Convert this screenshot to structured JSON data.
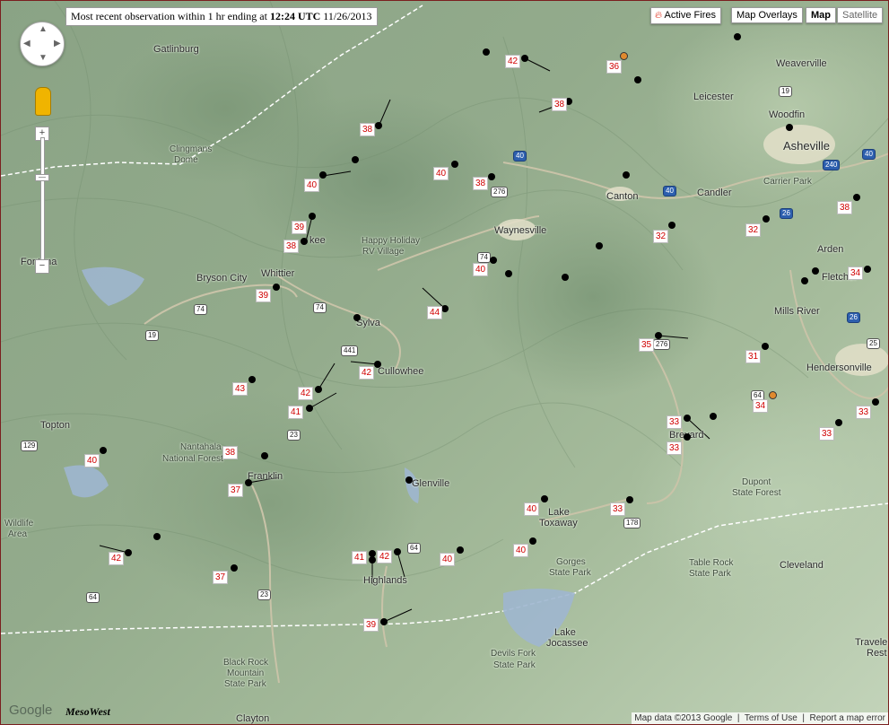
{
  "header": {
    "obs_prefix": "Most recent observation within 1 hr ending at ",
    "obs_time": "12:24 UTC",
    "obs_date": " 11/26/2013"
  },
  "controls": {
    "active_fires": "Active Fires",
    "map_overlays": "Map Overlays",
    "map": "Map",
    "satellite": "Satellite",
    "zoom_in": "+",
    "zoom_out": "−"
  },
  "footer": {
    "google": "Google",
    "mesowest": "MesoWest",
    "map_data": "Map data ©2013 Google",
    "terms": "Terms of Use",
    "report": "Report a map error"
  },
  "places": [
    {
      "name": "Gatlinburg"
    },
    {
      "name": "Clingmans"
    },
    {
      "name": "Dome"
    },
    {
      "name": "Fontana"
    },
    {
      "name": "Bryson City"
    },
    {
      "name": "Whittier"
    },
    {
      "name": "Happy Holiday"
    },
    {
      "name": "RV Village"
    },
    {
      "name": "Sylva"
    },
    {
      "name": "Cullowhee"
    },
    {
      "name": "Waynesville"
    },
    {
      "name": "Canton"
    },
    {
      "name": "Candler"
    },
    {
      "name": "Leicester"
    },
    {
      "name": "Weaverville"
    },
    {
      "name": "Woodfin"
    },
    {
      "name": "Asheville"
    },
    {
      "name": "Carrier Park"
    },
    {
      "name": "Arden"
    },
    {
      "name": "Fletcher"
    },
    {
      "name": "Mills River"
    },
    {
      "name": "Hendersonville"
    },
    {
      "name": "Topton"
    },
    {
      "name": "Nantahala"
    },
    {
      "name": "National Forest"
    },
    {
      "name": "Franklin"
    },
    {
      "name": "Glenville"
    },
    {
      "name": "Lake"
    },
    {
      "name": "Toxaway"
    },
    {
      "name": "Brevard"
    },
    {
      "name": "Dupont"
    },
    {
      "name": "State Forest"
    },
    {
      "name": "Highlands"
    },
    {
      "name": "Gorges"
    },
    {
      "name": "State Park"
    },
    {
      "name": "Table Rock"
    },
    {
      "name": "State Park"
    },
    {
      "name": "Cleveland"
    },
    {
      "name": "Lake"
    },
    {
      "name": "Jocassee"
    },
    {
      "name": "Devils Fork"
    },
    {
      "name": "State Park"
    },
    {
      "name": "Black Rock"
    },
    {
      "name": "Mountain"
    },
    {
      "name": "State Park"
    },
    {
      "name": "Clayton"
    },
    {
      "name": "Travelers"
    },
    {
      "name": "Rest"
    },
    {
      "name": "Wildlife"
    },
    {
      "name": "Area"
    },
    {
      "name": "kee"
    }
  ],
  "highways": [
    "40",
    "40",
    "40",
    "276",
    "74",
    "74",
    "441",
    "19",
    "74",
    "129",
    "23",
    "64",
    "64",
    "23",
    "178",
    "64",
    "26",
    "240",
    "19",
    "25",
    "26",
    "276"
  ],
  "observations": [
    {
      "value": "42",
      "color": "#d00000"
    },
    {
      "value": "36",
      "color": "#d00000"
    },
    {
      "value": "38",
      "color": "#d00000"
    },
    {
      "value": "38",
      "color": "#d00000"
    },
    {
      "value": "40",
      "color": "#d00000"
    },
    {
      "value": "40",
      "color": "#d00000"
    },
    {
      "value": "38",
      "color": "#d00000"
    },
    {
      "value": "39",
      "color": "#d00000"
    },
    {
      "value": "38",
      "color": "#d00000"
    },
    {
      "value": "32",
      "color": "#d00000"
    },
    {
      "value": "32",
      "color": "#d00000"
    },
    {
      "value": "38",
      "color": "#d00000"
    },
    {
      "value": "40",
      "color": "#d00000"
    },
    {
      "value": "34",
      "color": "#d00000"
    },
    {
      "value": "39",
      "color": "#d00000"
    },
    {
      "value": "44",
      "color": "#d00000"
    },
    {
      "value": "35",
      "color": "#d00000"
    },
    {
      "value": "31",
      "color": "#d00000"
    },
    {
      "value": "42",
      "color": "#d00000"
    },
    {
      "value": "43",
      "color": "#d00000"
    },
    {
      "value": "42",
      "color": "#d00000"
    },
    {
      "value": "41",
      "color": "#d00000"
    },
    {
      "value": "34",
      "color": "#d00000"
    },
    {
      "value": "33",
      "color": "#d00000"
    },
    {
      "value": "33",
      "color": "#d00000"
    },
    {
      "value": "33",
      "color": "#d00000"
    },
    {
      "value": "33",
      "color": "#d00000"
    },
    {
      "value": "40",
      "color": "#d00000"
    },
    {
      "value": "38",
      "color": "#d00000"
    },
    {
      "value": "37",
      "color": "#d00000"
    },
    {
      "value": "40",
      "color": "#d00000"
    },
    {
      "value": "33",
      "color": "#d00000"
    },
    {
      "value": "42",
      "color": "#d00000"
    },
    {
      "value": "37",
      "color": "#d00000"
    },
    {
      "value": "41",
      "color": "#d00000"
    },
    {
      "value": "42",
      "color": "#d00000"
    },
    {
      "value": "40",
      "color": "#d00000"
    },
    {
      "value": "40",
      "color": "#d00000"
    },
    {
      "value": "39",
      "color": "#d00000"
    }
  ]
}
